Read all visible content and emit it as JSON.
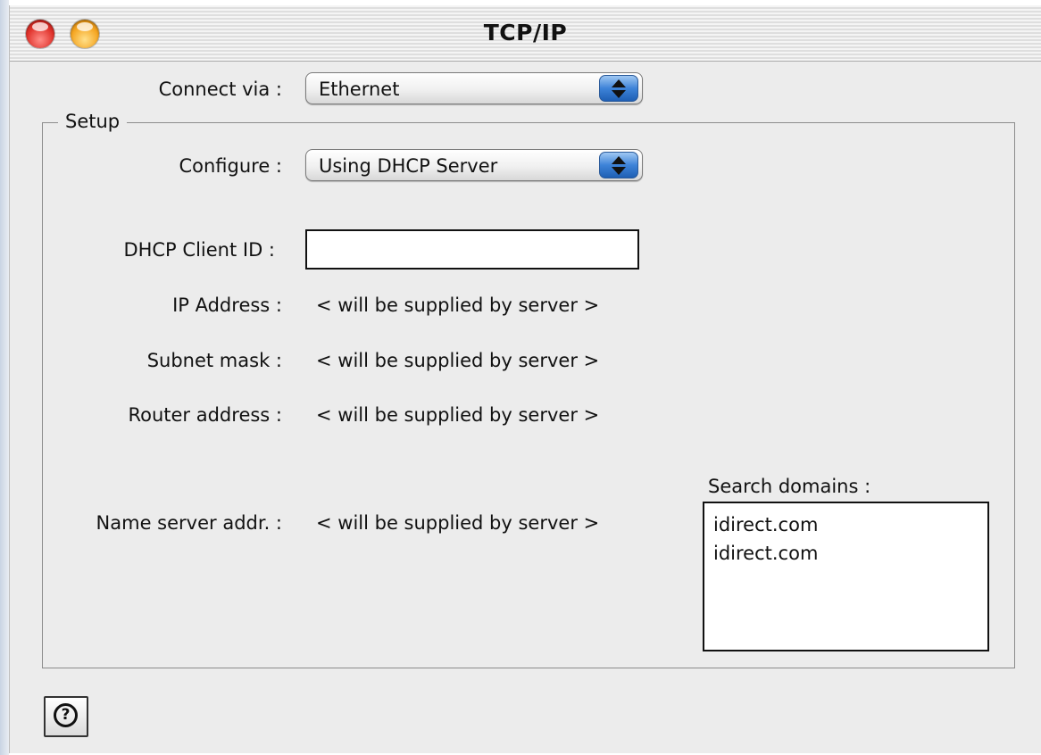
{
  "window": {
    "title": "TCP/IP"
  },
  "connect_via": {
    "label": "Connect via :",
    "value": "Ethernet"
  },
  "setup": {
    "label": "Setup",
    "configure": {
      "label": "Configure :",
      "value": "Using DHCP Server"
    },
    "dhcp_client_id": {
      "label": "DHCP Client ID :",
      "value": ""
    },
    "ip_address": {
      "label": "IP Address :",
      "value": "< will be supplied by server >"
    },
    "subnet_mask": {
      "label": "Subnet mask :",
      "value": "< will be supplied by server >"
    },
    "router_address": {
      "label": "Router address :",
      "value": "< will be supplied by server >"
    },
    "name_server": {
      "label": "Name server addr. :",
      "value": "< will be supplied by server >"
    },
    "search_domains": {
      "label": "Search domains :",
      "items": [
        "idirect.com",
        "idirect.com"
      ]
    }
  },
  "help": {
    "glyph": "?"
  },
  "icons": {
    "close": "close-icon",
    "minimize": "minimize-icon",
    "popup_arrows": "up-down-arrows-icon",
    "help": "question-mark-icon"
  },
  "colors": {
    "close_button": "#e0332c",
    "minimize_button": "#f5a623",
    "popup_arrow_blue": "#3d83d8",
    "window_background": "#ececec"
  }
}
